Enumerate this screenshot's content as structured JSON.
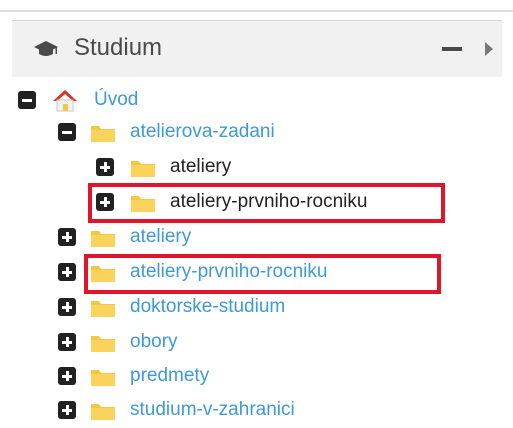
{
  "panel": {
    "title": "Studium",
    "icon": "graduation-cap-icon"
  },
  "tree": {
    "root": {
      "label": "Úvod",
      "icon": "home-icon",
      "state": "expanded"
    },
    "atelierova_zadani": {
      "label": "atelierova-zadani",
      "state": "expanded"
    },
    "children_of_atelierova_zadani": [
      {
        "label": "ateliery",
        "state": "collapsed"
      },
      {
        "label": "ateliery-prvniho-rocniku",
        "state": "collapsed",
        "highlighted": true
      }
    ],
    "siblings": [
      {
        "label": "ateliery",
        "state": "collapsed"
      },
      {
        "label": "ateliery-prvniho-rocniku",
        "state": "collapsed",
        "highlighted": true
      },
      {
        "label": "doktorske-studium",
        "state": "collapsed"
      },
      {
        "label": "obory",
        "state": "collapsed"
      },
      {
        "label": "predmety",
        "state": "collapsed"
      },
      {
        "label": "studium-v-zahranici",
        "state": "collapsed"
      }
    ]
  },
  "colors": {
    "link": "#3d9ad6",
    "highlight": "#e0142a",
    "folder": "#f5c842",
    "home_roof": "#d9332b"
  }
}
